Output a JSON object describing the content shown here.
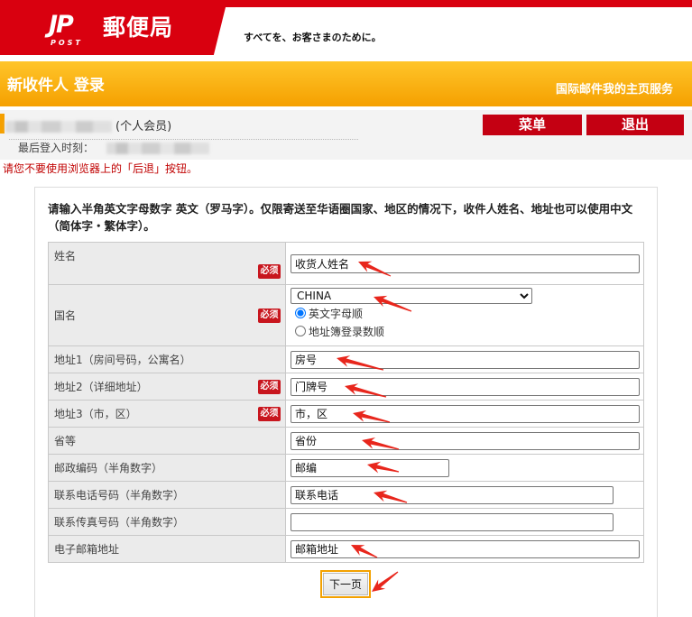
{
  "header": {
    "logo_mark": "JP",
    "logo_sub": "POST",
    "brand": "郵便局",
    "slogan": "すべてを、お客さまのために。"
  },
  "title_bar": {
    "title": "新收件人 登录",
    "service_link": "国际邮件我的主页服务"
  },
  "user": {
    "member_type": "(个人会员)",
    "last_login_label": "最后登入时刻："
  },
  "nav": {
    "menu_label": "菜单",
    "logout_label": "退出"
  },
  "warning": "请您不要使用浏览器上的「后退」按钮。",
  "form": {
    "instruction": "请输入半角英文字母数字 英文（罗马字）。仅限寄送至华语圈国家、地区的情况下，收件人姓名、地址也可以使用中文（简体字・繁体字）。",
    "required_label": "必须",
    "fields": [
      {
        "label": "姓名",
        "required": true,
        "value": "收货人姓名"
      },
      {
        "label": "国名",
        "required": true,
        "selected": "CHINA",
        "sort_options": [
          {
            "label": "英文字母顺",
            "checked": true
          },
          {
            "label": "地址簿登录数顺",
            "checked": false
          }
        ]
      },
      {
        "label": "地址1（房间号码，公寓名）",
        "required": false,
        "value": "房号"
      },
      {
        "label": "地址2（详细地址）",
        "required": true,
        "value": "门牌号"
      },
      {
        "label": "地址3（市，区）",
        "required": true,
        "value": "市，区"
      },
      {
        "label": "省等",
        "required": false,
        "value": "省份"
      },
      {
        "label": "邮政编码（半角数字）",
        "required": false,
        "value": "邮编"
      },
      {
        "label": "联系电话号码（半角数字）",
        "required": false,
        "value": "联系电话"
      },
      {
        "label": "联系传真号码（半角数字）",
        "required": false,
        "value": ""
      },
      {
        "label": "电子邮箱地址",
        "required": false,
        "value": "邮箱地址"
      }
    ],
    "next_label": "下一页"
  },
  "colors": {
    "brand_red": "#d9000f",
    "title_orange": "#f5a000",
    "button_red": "#c40012",
    "warning_red": "#c00000",
    "badge_red": "#c8161e",
    "annotation_red": "#e8261c"
  }
}
